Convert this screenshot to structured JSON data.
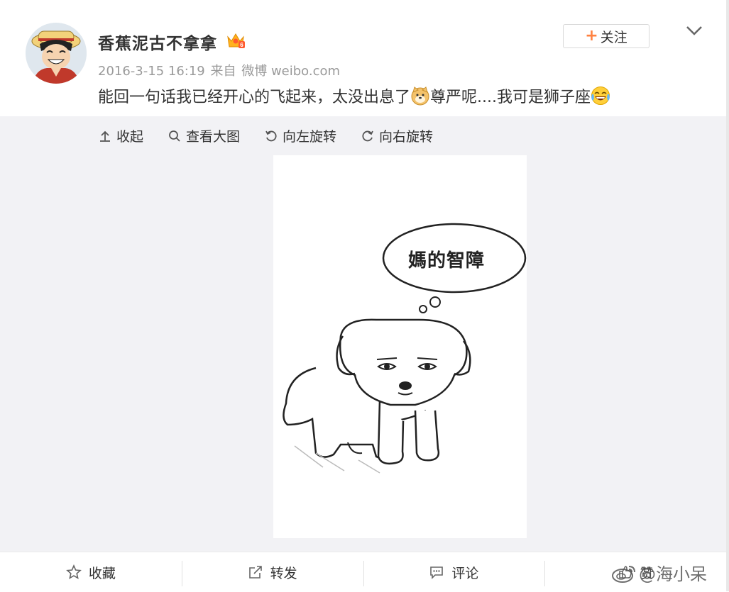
{
  "post": {
    "username": "香蕉泥古不拿拿",
    "date": "2016-3-15 16:19",
    "source_prefix": "来自",
    "source": "微博 weibo.com",
    "text_part1": "能回一句话我已经开心的飞起来，太没出息了",
    "text_part2": "尊严呢....我可是狮子座",
    "follow_label": "关注"
  },
  "media_toolbar": {
    "collapse": "收起",
    "view_large": "查看大图",
    "rotate_left": "向左旋转",
    "rotate_right": "向右旋转"
  },
  "image": {
    "bubble_text": "媽的智障"
  },
  "actions": {
    "favorite": "收藏",
    "repost": "转发",
    "comment": "评论",
    "like": "赞"
  },
  "watermark": {
    "text": "@海小呆"
  },
  "colors": {
    "accent": "#ff8140",
    "media_bg": "#f2f2f5",
    "meta_text": "#9a9a9a"
  }
}
